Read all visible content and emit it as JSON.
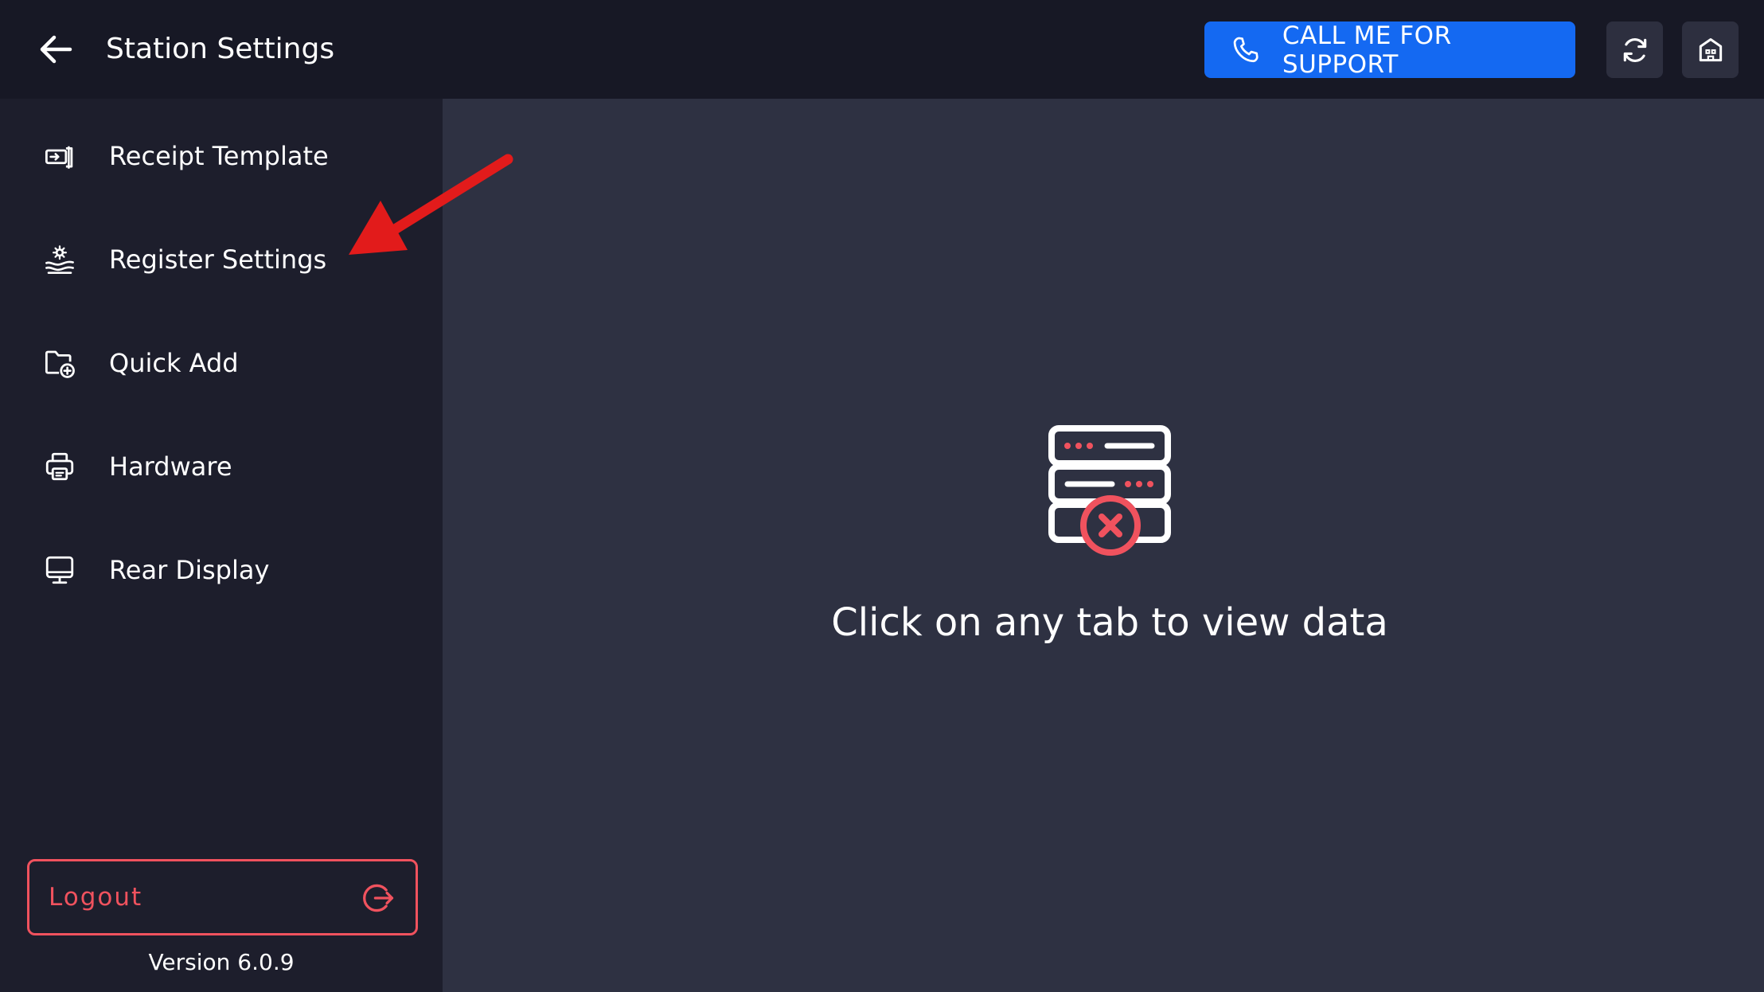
{
  "header": {
    "title": "Station Settings",
    "back_icon": "arrow-left-icon",
    "support_label": "CALL ME FOR SUPPORT",
    "support_icon": "phone-icon",
    "refresh_icon": "refresh-icon",
    "store_icon": "store-icon"
  },
  "sidebar": {
    "items": [
      {
        "label": "Receipt Template",
        "icon": "receipt-printer-icon"
      },
      {
        "label": "Register Settings",
        "icon": "register-settings-icon"
      },
      {
        "label": "Quick Add",
        "icon": "folder-add-icon"
      },
      {
        "label": "Hardware",
        "icon": "printer-icon"
      },
      {
        "label": "Rear Display",
        "icon": "monitor-icon"
      }
    ],
    "logout_label": "Logout",
    "logout_icon": "logout-icon",
    "version": "Version 6.0.9"
  },
  "main": {
    "empty_icon": "server-error-icon",
    "empty_message": "Click on any tab to view data"
  },
  "colors": {
    "accent": "#1469f2",
    "danger": "#f0525e",
    "header_bg": "#171825",
    "sidebar_bg": "#1d1e2c",
    "content_bg": "#2e3142",
    "annotation": "#e21b1b"
  }
}
